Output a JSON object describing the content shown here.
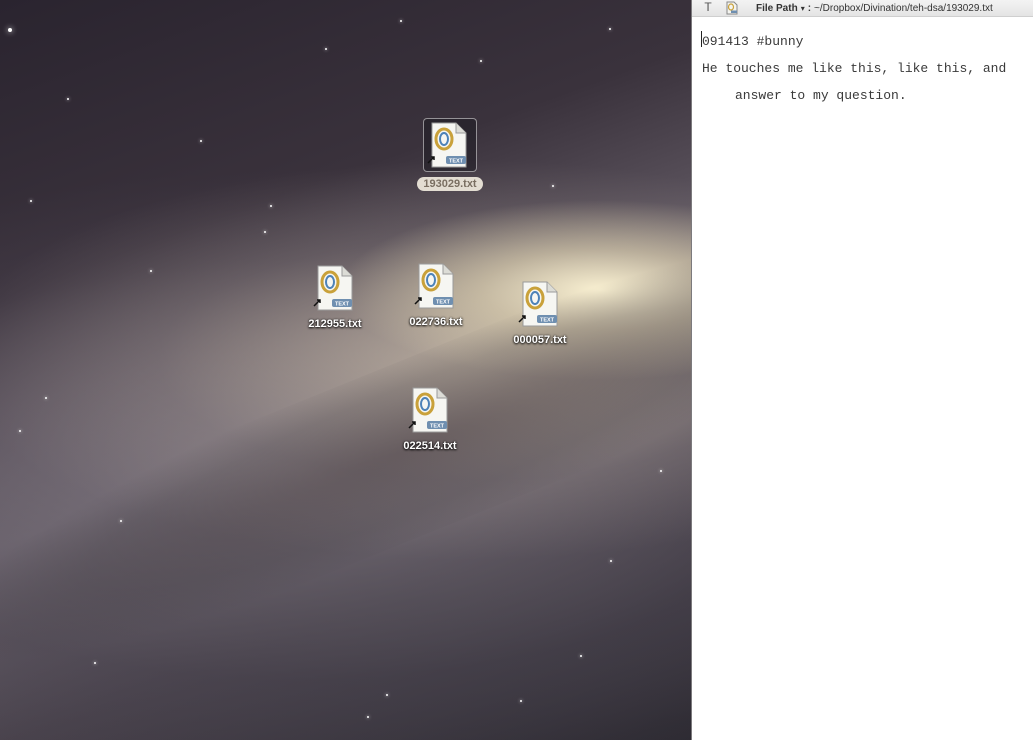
{
  "desktop": {
    "files": [
      {
        "name": "193029.txt",
        "selected": true
      },
      {
        "name": "212955.txt",
        "selected": false
      },
      {
        "name": "022736.txt",
        "selected": false
      },
      {
        "name": "000057.txt",
        "selected": false
      },
      {
        "name": "022514.txt",
        "selected": false
      }
    ],
    "file_icon_badge": "TEXT",
    "file_icon": "text-document-alias-icon"
  },
  "editor": {
    "toolbar": {
      "font_icon": "T",
      "path_label": "File Path",
      "path_caret": "▾",
      "path_colon": ":",
      "path_value": "~/Dropbox/Divination/teh-dsa/193029.txt"
    },
    "lines": [
      "091413 #bunny",
      "He touches me like this, like this, and",
      "answer to my question."
    ]
  },
  "colors": {
    "selection_label_bg": "#e3ddd2",
    "editor_bg": "#ffffff",
    "editor_text": "#3a3a3a"
  }
}
